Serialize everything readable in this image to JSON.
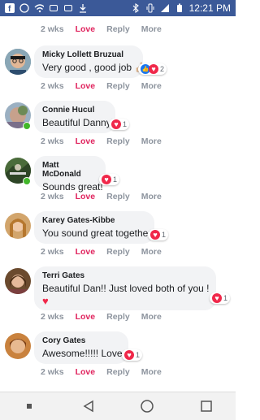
{
  "status_bar": {
    "time": "12:21 PM"
  },
  "actions": {
    "time_label": "2 wks",
    "love_label": "Love",
    "reply_label": "Reply",
    "more_label": "More"
  },
  "comments": [
    {
      "name": "Micky Lollett Bruzual",
      "text": "Very good , good job",
      "emoji": "👍🏼",
      "reaction_count": "2"
    },
    {
      "name": "Connie Hucul",
      "text": "Beautiful Danny!",
      "reaction_count": "1"
    },
    {
      "name": "Matt McDonald",
      "text": "Sounds great!",
      "reaction_count": "1"
    },
    {
      "name": "Karey Gates-Kibbe",
      "text": "You sound great together.",
      "reaction_count": "1"
    },
    {
      "name": "Terri Gates",
      "text": "Beautiful Dan!! Just loved both of you !",
      "reaction_count": "1"
    },
    {
      "name": "Cory Gates",
      "text": "Awesome!!!!! Love it",
      "reaction_count": "1"
    }
  ],
  "colors": {
    "facebook_blue": "#3b5998",
    "love_red": "#e0245e",
    "online_green": "#42b72a"
  }
}
